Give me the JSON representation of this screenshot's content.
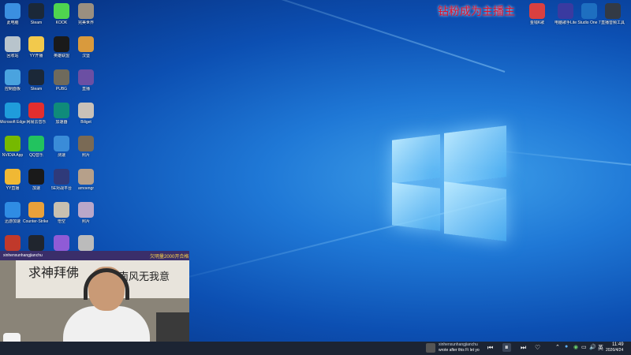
{
  "desktop_icons": [
    {
      "label": "此电脑",
      "icon": "computer-icon",
      "color": "#3b8fe0"
    },
    {
      "label": "Steam",
      "icon": "steam-icon",
      "color": "#1b2838"
    },
    {
      "label": "KOOK",
      "icon": "kook-icon",
      "color": "#4fd44f"
    },
    {
      "label": "完美世界",
      "icon": "perfect-world-icon",
      "color": "#9a8f80"
    },
    {
      "label": "回收站",
      "icon": "recycle-bin-icon",
      "color": "#b8c4cc"
    },
    {
      "label": "YY开播",
      "icon": "yy-live-icon",
      "color": "#f2c94c"
    },
    {
      "label": "英雄联盟",
      "icon": "league-icon",
      "color": "#1a1a1a"
    },
    {
      "label": "汉堡",
      "icon": "burger-icon",
      "color": "#d99a3d"
    },
    {
      "label": "控制面板",
      "icon": "control-panel-icon",
      "color": "#4aa3df"
    },
    {
      "label": "Steam",
      "icon": "steam-icon",
      "color": "#1b2838"
    },
    {
      "label": "PUBG",
      "icon": "pubg-icon",
      "color": "#6f6a5c"
    },
    {
      "label": "直播",
      "icon": "live-icon",
      "color": "#6b4fa3"
    },
    {
      "label": "Microsoft Edge",
      "icon": "edge-icon",
      "color": "#1f9cdb"
    },
    {
      "label": "网易云音乐",
      "icon": "netease-music-icon",
      "color": "#e22e2e"
    },
    {
      "label": "加速器",
      "icon": "accelerator-icon",
      "color": "#0f8b7a"
    },
    {
      "label": "Biliget",
      "icon": "biliget-icon",
      "color": "#c9c1b8"
    },
    {
      "label": "NVIDIA App",
      "icon": "nvidia-icon",
      "color": "#76b900"
    },
    {
      "label": "QQ音乐",
      "icon": "qq-music-icon",
      "color": "#22c35f"
    },
    {
      "label": "测速",
      "icon": "speedometer-icon",
      "color": "#3a8cd8"
    },
    {
      "label": "照片",
      "icon": "photo-icon",
      "color": "#7a6a55"
    },
    {
      "label": "YY直播",
      "icon": "yy-icon",
      "color": "#f0b834"
    },
    {
      "label": "加速",
      "icon": "arrow-icon",
      "color": "#1a1a1a"
    },
    {
      "label": "5E对战平台",
      "icon": "5e-icon",
      "color": "#2f3a7a"
    },
    {
      "label": "arnoengr",
      "icon": "avatar-icon",
      "color": "#b6a08a"
    },
    {
      "label": "迅游加速",
      "icon": "xunyou-icon",
      "color": "#2f8ce3"
    },
    {
      "label": "Counter-Strike 2",
      "icon": "cs2-icon",
      "color": "#e9a13b"
    },
    {
      "label": "悟空",
      "icon": "wukong-icon",
      "color": "#c8c0b0"
    },
    {
      "label": "照片",
      "icon": "photo-icon",
      "color": "#b9a7c9"
    },
    {
      "label": "",
      "icon": "app-icon",
      "color": "#c0392b"
    },
    {
      "label": "",
      "icon": "triangle-icon",
      "color": "#20252e"
    },
    {
      "label": "",
      "icon": "game-icon",
      "color": "#8f5bd6"
    },
    {
      "label": "",
      "icon": "app-icon",
      "color": "#bbbbbb"
    }
  ],
  "top_right_icons": [
    {
      "label": "金钱K歌",
      "icon": "karaoke-icon",
      "color": "#d94040"
    },
    {
      "label": "电脑歌手Lite",
      "icon": "singer-icon",
      "color": "#3a3aa0"
    },
    {
      "label": "Studio One 7",
      "icon": "studio-one-icon",
      "color": "#1e6fc0"
    },
    {
      "label": "直播音频工具",
      "icon": "audio-tool-icon",
      "color": "#333a45"
    }
  ],
  "banner_text": "钻粉成为主播主",
  "webcam": {
    "overlay_text": "欠明量2000开合格",
    "caption_top": "xinhenxunhangjianchu",
    "wall_text": "求神拜佛",
    "wall_text_right": "南风无我意"
  },
  "taskbar": {
    "media_title": "xinhenxunhangjianchu",
    "media_subtitle": "wrote after this Fi let yo",
    "time": "11:49",
    "date": "2026/4/24",
    "ime": "英",
    "battery_icon": "battery-icon"
  }
}
